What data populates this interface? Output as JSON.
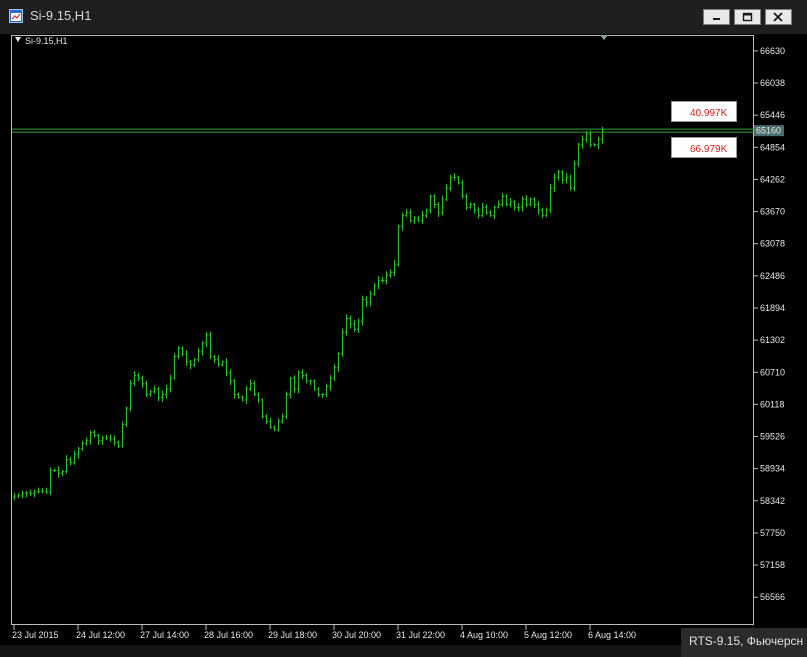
{
  "window": {
    "title": "Si-9.15,H1",
    "symbol_label": "Si-9.15,H1",
    "other_tab": "RTS-9.15, Фьючерсн",
    "minimize_icon": "minimize-icon",
    "maximize_icon": "maximize-icon",
    "close_icon": "close-icon"
  },
  "colors": {
    "background": "#000000",
    "candle": "#1fc21f",
    "horizontal_line": "#35a035",
    "volume_text": "#e0201c",
    "price_tag": "#4a6d6d"
  },
  "chart_data": {
    "type": "bar",
    "title": "Si-9.15,H1",
    "current_price": 65160,
    "current_price_label": "65160",
    "volume_labels": [
      "40.997K",
      "66.979K"
    ],
    "ylim": [
      56073,
      66904
    ],
    "yticks": [
      66630,
      66038,
      65446,
      64854,
      64262,
      63670,
      63078,
      62486,
      61894,
      61302,
      60710,
      60118,
      59526,
      58934,
      58342,
      57750,
      57158,
      56566
    ],
    "xticks": [
      "23 Jul 2015",
      "24 Jul 12:00",
      "27 Jul 14:00",
      "28 Jul 16:00",
      "29 Jul 18:00",
      "30 Jul 20:00",
      "31 Jul 22:00",
      "4 Aug 10:00",
      "5 Aug 12:00",
      "6 Aug 14:00"
    ],
    "xtick_bar_index": [
      0,
      16,
      32,
      48,
      64,
      80,
      96,
      112,
      128,
      144
    ],
    "closes": [
      58430,
      58450,
      58480,
      58490,
      58480,
      58510,
      58520,
      58520,
      58500,
      58900,
      58900,
      58850,
      58880,
      59100,
      59050,
      59200,
      59300,
      59400,
      59450,
      59600,
      59550,
      59450,
      59500,
      59500,
      59480,
      59420,
      59350,
      59750,
      60050,
      60500,
      60650,
      60600,
      60500,
      60300,
      60350,
      60400,
      60250,
      60300,
      60400,
      60600,
      61000,
      61150,
      61050,
      60900,
      60850,
      60950,
      61100,
      61250,
      61400,
      61000,
      60950,
      60850,
      60900,
      60700,
      60550,
      60300,
      60250,
      60200,
      60400,
      60500,
      60300,
      60200,
      59900,
      59800,
      59700,
      59650,
      59800,
      59900,
      60300,
      60600,
      60400,
      60700,
      60650,
      60550,
      60550,
      60400,
      60300,
      60300,
      60450,
      60600,
      60800,
      61050,
      61450,
      61700,
      61600,
      61500,
      61650,
      62050,
      62000,
      62150,
      62300,
      62400,
      62400,
      62500,
      62550,
      62700,
      63400,
      63600,
      63650,
      63500,
      63550,
      63500,
      63600,
      63700,
      63950,
      63800,
      63650,
      63900,
      64100,
      64300,
      64300,
      64200,
      63950,
      63750,
      63800,
      63700,
      63600,
      63750,
      63650,
      63600,
      63750,
      63800,
      63950,
      63800,
      63850,
      63750,
      63750,
      63900,
      63800,
      63900,
      63800,
      63700,
      63600,
      63700,
      64100,
      64300,
      64400,
      64250,
      64300,
      64100,
      64550,
      64900,
      65000,
      65100,
      64900,
      64900,
      65000,
      65160
    ]
  }
}
